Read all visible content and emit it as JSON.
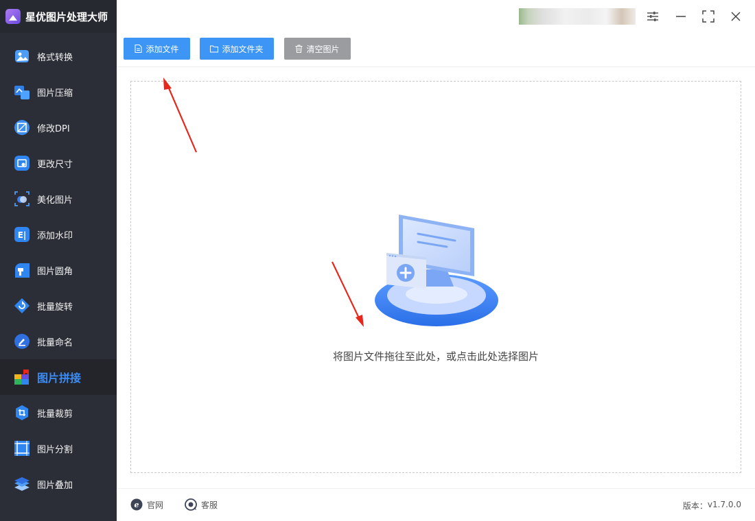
{
  "app": {
    "title": "星优图片处理大师"
  },
  "sidebar": {
    "items": [
      {
        "label": "格式转换",
        "icon": "format-convert-icon"
      },
      {
        "label": "图片压缩",
        "icon": "image-compress-icon"
      },
      {
        "label": "修改DPI",
        "icon": "dpi-icon"
      },
      {
        "label": "更改尺寸",
        "icon": "resize-icon"
      },
      {
        "label": "美化图片",
        "icon": "beautify-icon"
      },
      {
        "label": "添加水印",
        "icon": "watermark-icon"
      },
      {
        "label": "图片圆角",
        "icon": "round-corner-icon"
      },
      {
        "label": "批量旋转",
        "icon": "rotate-icon"
      },
      {
        "label": "批量命名",
        "icon": "rename-icon"
      },
      {
        "label": "图片拼接",
        "icon": "stitch-icon",
        "active": true
      },
      {
        "label": "批量裁剪",
        "icon": "crop-icon"
      },
      {
        "label": "图片分割",
        "icon": "split-icon"
      },
      {
        "label": "图片叠加",
        "icon": "overlay-icon"
      }
    ]
  },
  "toolbar": {
    "add_file": "添加文件",
    "add_folder": "添加文件夹",
    "clear_images": "清空图片"
  },
  "dropzone": {
    "hint": "将图片文件拖往至此处，或点击此处选择图片"
  },
  "footer": {
    "website": "官网",
    "support": "客服",
    "version_label": "版本：",
    "version_value": "v1.7.0.0"
  },
  "colors": {
    "accent": "#3d95f5",
    "sidebar_bg": "#2b2e36",
    "active_text": "#3b8cf5",
    "annotation_arrow": "#e8271c"
  }
}
